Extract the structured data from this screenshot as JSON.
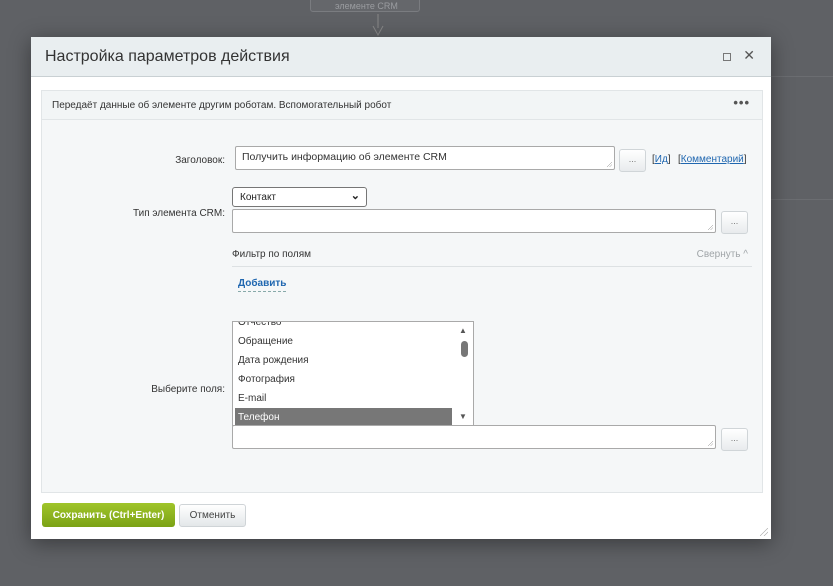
{
  "background": {
    "node_label": "элементе CRM"
  },
  "dialog": {
    "title": "Настройка параметров действия",
    "description": "Передаёт данные об элементе другим роботам. Вспомогательный робот",
    "more": "•••",
    "close": "✕",
    "fields": {
      "title_label": "Заголовок:",
      "title_value": "Получить информацию об элементе CRM",
      "dots": "...",
      "id_link": "Ид",
      "comment_link": "Комментарий",
      "type_label": "Тип элемента CRM:",
      "type_selected": "Контакт",
      "filter_title": "Фильтр по полям",
      "collapse": "Свернуть",
      "add": "Добавить",
      "choose_label": "Выберите поля:",
      "options": [
        "Отчество",
        "Обращение",
        "Дата рождения",
        "Фотография",
        "E-mail",
        "Телефон"
      ],
      "selected_option": "Телефон"
    },
    "buttons": {
      "save": "Сохранить (Ctrl+Enter)",
      "cancel": "Отменить"
    }
  }
}
